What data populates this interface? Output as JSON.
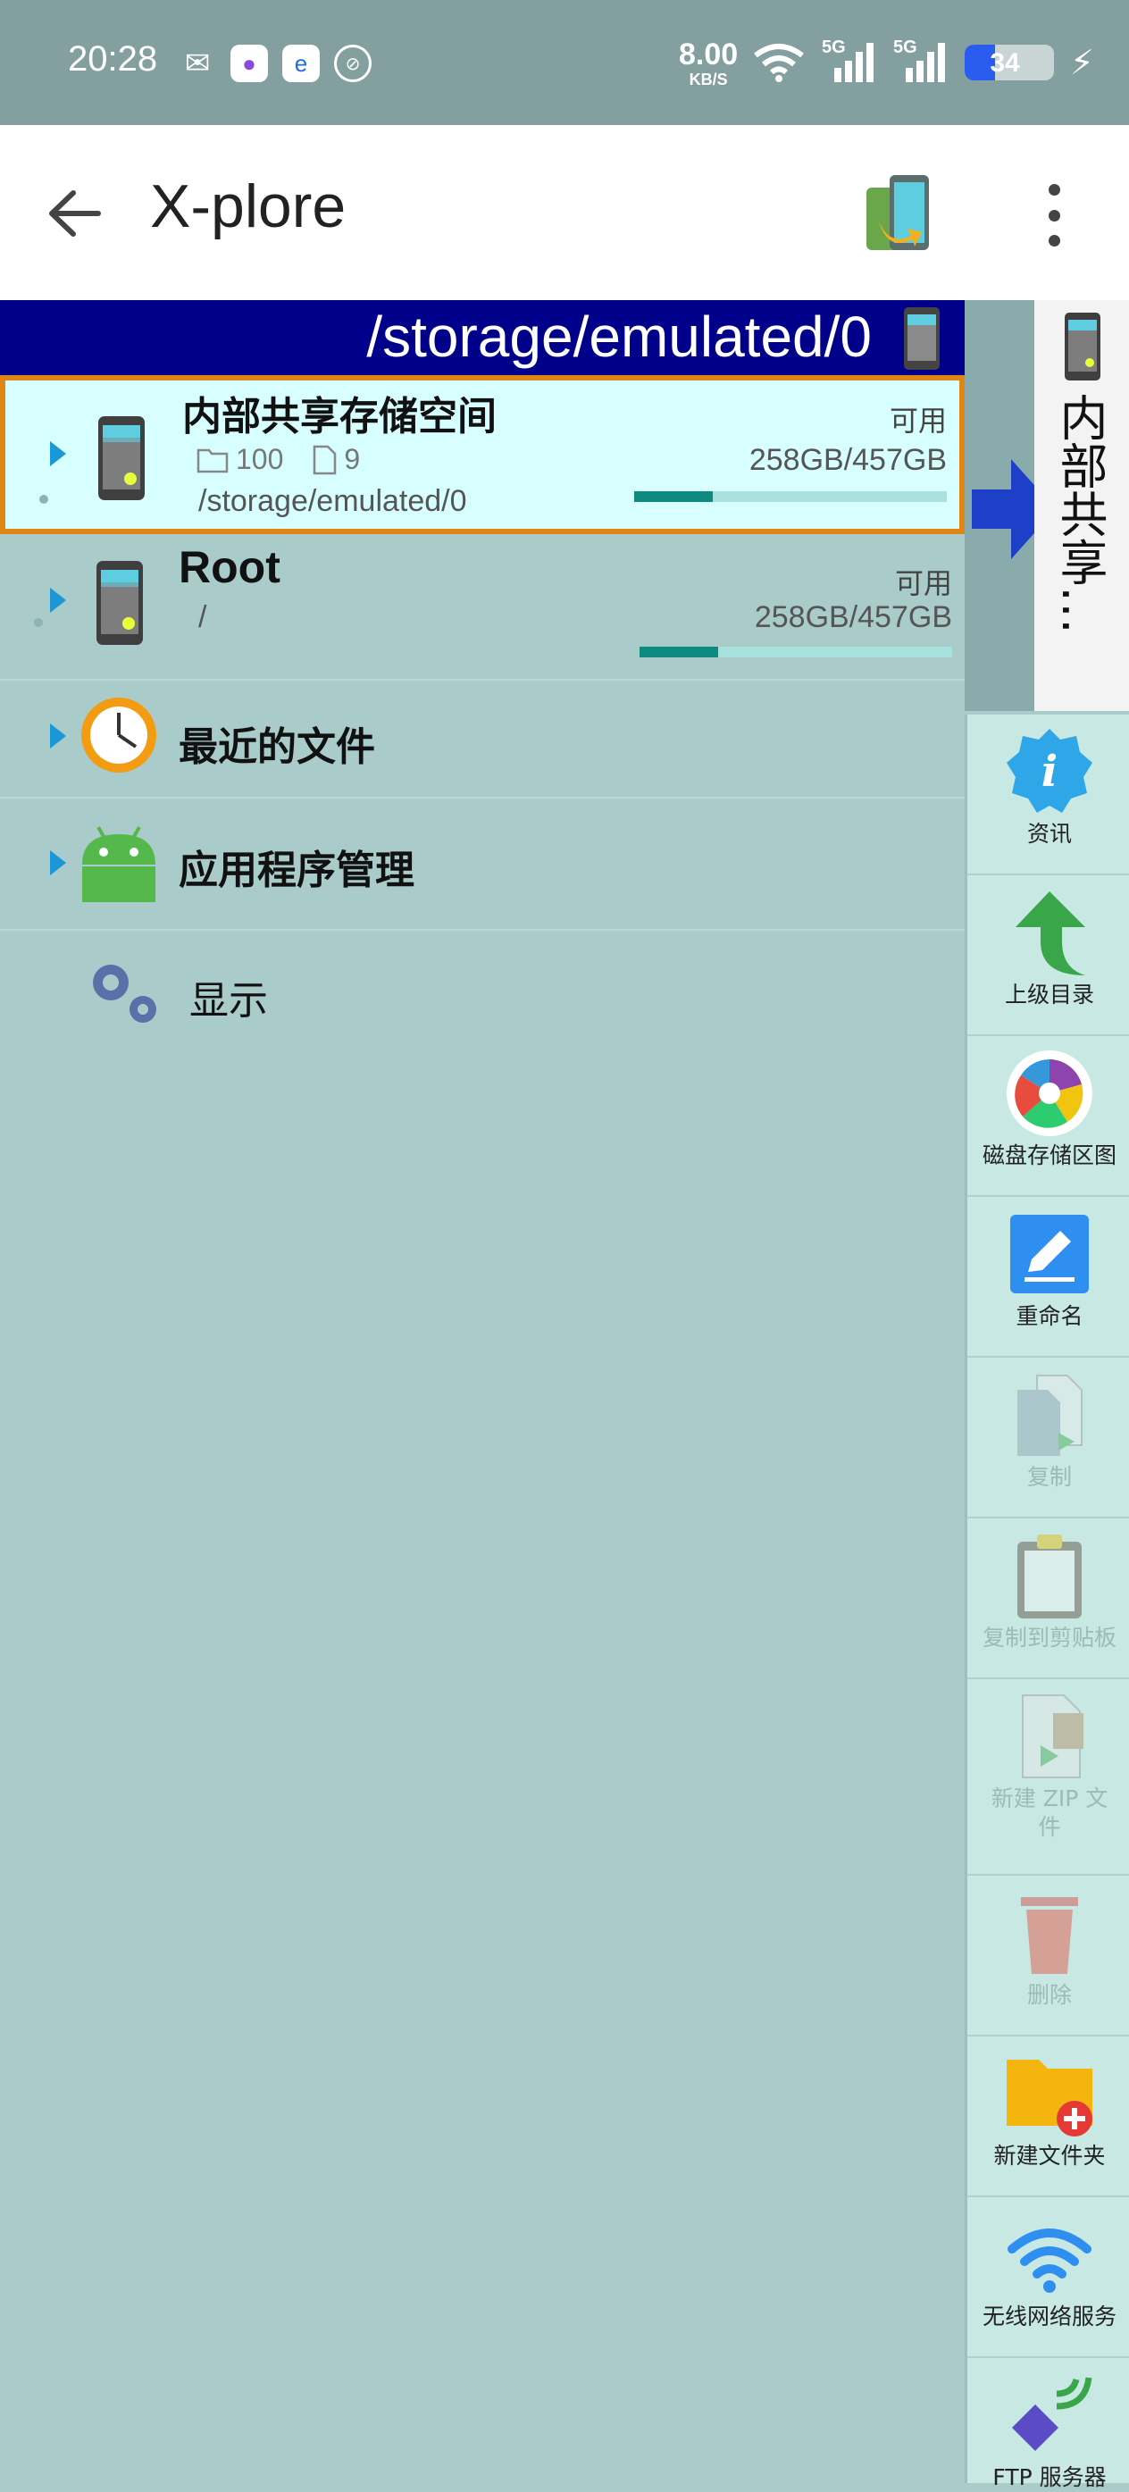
{
  "status_bar": {
    "time": "20:28",
    "net_speed_value": "8.00",
    "net_speed_unit": "KB/S",
    "signal_1_label": "5G",
    "signal_2_label": "5G",
    "battery_level": "34",
    "battery_fraction": 0.34,
    "icons": [
      "wechat-icon",
      "app-icon",
      "app-icon",
      "nfc-icon",
      "wifi-icon",
      "charging-icon"
    ]
  },
  "app_bar": {
    "title": "X-plore"
  },
  "path_bar": {
    "path": "/storage/emulated/0"
  },
  "rows": {
    "internal": {
      "title": "内部共享存储空间",
      "folder_count": "100",
      "file_count": "9",
      "path": "/storage/emulated/0",
      "available_label": "可用",
      "size": "258GB/457GB",
      "used_fraction": 0.25
    },
    "root": {
      "title": "Root",
      "path": "/",
      "available_label": "可用",
      "size": "258GB/457GB",
      "used_fraction": 0.25
    },
    "recent": {
      "title": "最近的文件"
    },
    "apps": {
      "title": "应用程序管理"
    },
    "display": {
      "title": "显示"
    }
  },
  "side_tab": {
    "label": "内部共享…"
  },
  "actions": [
    {
      "label": "资讯",
      "enabled": true
    },
    {
      "label": "上级目录",
      "enabled": true
    },
    {
      "label": "磁盘存储区图",
      "enabled": true
    },
    {
      "label": "重命名",
      "enabled": true
    },
    {
      "label": "复制",
      "enabled": false
    },
    {
      "label": "复制到剪贴板",
      "enabled": false
    },
    {
      "label": "新建 ZIP 文件",
      "enabled": false
    },
    {
      "label": "删除",
      "enabled": false
    },
    {
      "label": "新建文件夹",
      "enabled": true
    },
    {
      "label": "无线网络服务",
      "enabled": true
    },
    {
      "label": "FTP 服务器",
      "enabled": true
    }
  ]
}
